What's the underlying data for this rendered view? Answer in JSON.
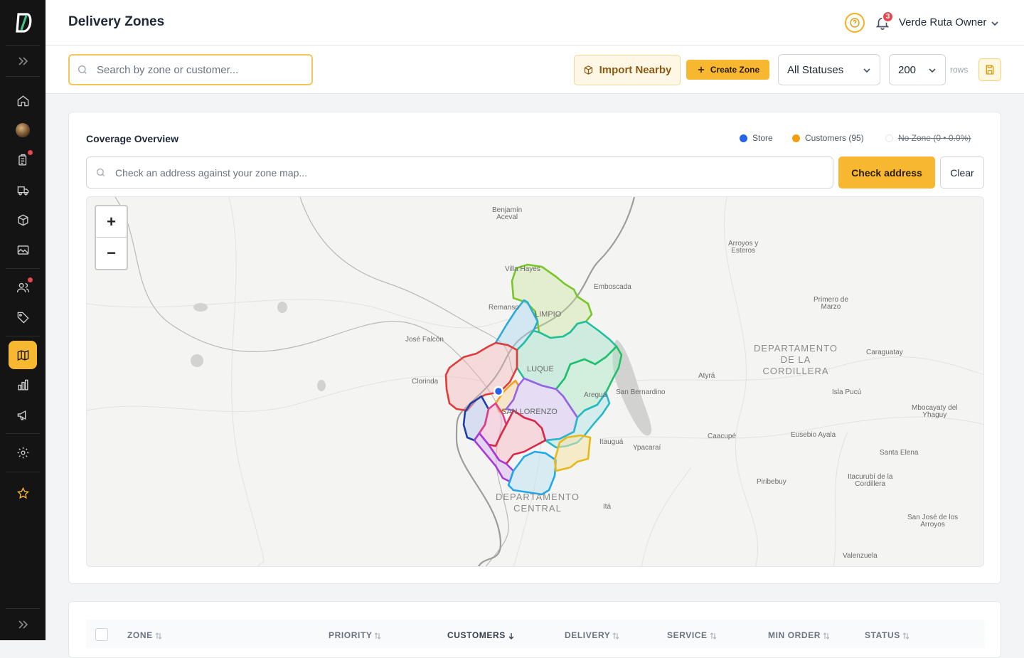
{
  "sidebar": {
    "items": [
      {
        "name": "home-icon"
      },
      {
        "name": "avatar"
      },
      {
        "name": "orders-icon",
        "badge": true
      },
      {
        "name": "truck-icon"
      },
      {
        "name": "box-icon"
      },
      {
        "name": "image-icon"
      },
      {
        "name": "users-icon",
        "badge": true
      },
      {
        "name": "tag-icon"
      },
      {
        "name": "map-icon",
        "active": true
      },
      {
        "name": "bar-chart-icon"
      },
      {
        "name": "megaphone-icon"
      },
      {
        "name": "gear-icon"
      },
      {
        "name": "star-icon"
      }
    ]
  },
  "header": {
    "title": "Delivery Zones",
    "notifications_count": "3",
    "user_name": "Verde Ruta Owner"
  },
  "toolbar": {
    "search_placeholder": "Search by zone or customer...",
    "import_label": "Import Nearby",
    "create_label": "Create Zone",
    "status_filter": "All Statuses",
    "rows_value": "200",
    "rows_label": "rows"
  },
  "coverage": {
    "title": "Coverage Overview",
    "legend": [
      {
        "label": "Store",
        "color": "#2563eb"
      },
      {
        "label": "Customers (95)",
        "color": "#f59e0b"
      },
      {
        "label": "No Zone (0 • 0.0%)",
        "color": "#e5e7eb",
        "disabled": true
      }
    ],
    "address_placeholder": "Check an address against your zone map...",
    "check_label": "Check address",
    "clear_label": "Clear"
  },
  "map": {
    "zoom_in": "+",
    "zoom_out": "−",
    "places": {
      "benjamin": [
        "Benjamín",
        "Aceval"
      ],
      "arroyos": [
        "Arroyos y",
        "Esteros"
      ],
      "villa_hayes": "Villa Hayes",
      "emboscada": "Emboscada",
      "primero": [
        "Primero de",
        "Marzo"
      ],
      "remanso": "Remanso",
      "limpio": "LIMPIO",
      "jose_falcon": "José Falcón",
      "depto_cordillera": [
        "DEPARTAMENTO",
        "DE LA",
        "CORDILLERA"
      ],
      "caraguatay": "Caraguatay",
      "clorinda": "Clorinda",
      "luque": "LUQUE",
      "atyra": "Atyrá",
      "aregua": "Areguá",
      "san_bernardino": "San Bernardino",
      "isla_pucu": "Isla Pucú",
      "san_lorenzo": "SAN LORENZO",
      "mbocayaty": [
        "Mbocayaty del",
        "Yhaguy"
      ],
      "caacupe": "Caacupé",
      "eusebio": "Eusebio Ayala",
      "itaugua": "Itauguá",
      "ypacarai": "Ypacaraí",
      "santa_elena": "Santa Elena",
      "piribebuy": "Piribebuy",
      "itacurubi": [
        "Itacurubí de la",
        "Cordillera"
      ],
      "depto_central": [
        "DEPARTAMENTO",
        "CENTRAL"
      ],
      "ita": "Itá",
      "san_jose": [
        "San José de los",
        "Arroyos"
      ],
      "valenzuela": "Valenzuela"
    }
  },
  "table": {
    "columns": [
      {
        "label": "ZONE",
        "sort": "none"
      },
      {
        "label": "PRIORITY",
        "sort": "none"
      },
      {
        "label": "CUSTOMERS",
        "sort": "desc"
      },
      {
        "label": "DELIVERY",
        "sort": "none"
      },
      {
        "label": "SERVICE",
        "sort": "none"
      },
      {
        "label": "MIN ORDER",
        "sort": "none"
      },
      {
        "label": "STATUS",
        "sort": "none"
      }
    ]
  }
}
